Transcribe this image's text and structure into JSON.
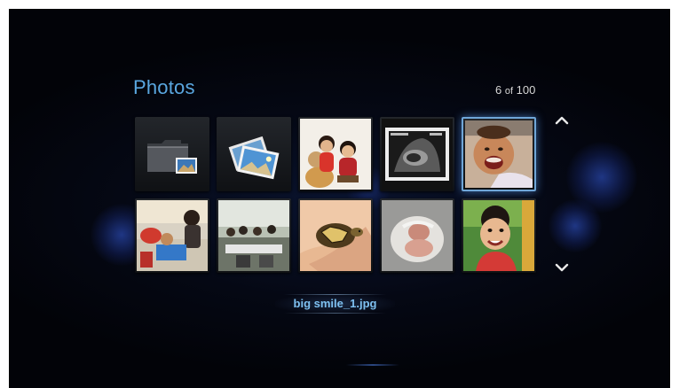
{
  "header": {
    "title": "Photos",
    "counter_current": "6",
    "counter_of": "of",
    "counter_total": "100"
  },
  "grid": {
    "items": [
      {
        "type": "folder",
        "icon": "folder-icon"
      },
      {
        "type": "slideshow",
        "icon": "photo-stack-icon"
      },
      {
        "type": "photo",
        "subject": "two children with teddy bear"
      },
      {
        "type": "photo",
        "subject": "ultrasound image"
      },
      {
        "type": "photo",
        "subject": "smiling baby",
        "selected": true
      },
      {
        "type": "photo",
        "subject": "child at party table"
      },
      {
        "type": "photo",
        "subject": "group at dinner table"
      },
      {
        "type": "photo",
        "subject": "small tortoise in hand"
      },
      {
        "type": "photo",
        "subject": "newborn baby"
      },
      {
        "type": "photo",
        "subject": "smiling boy outdoors"
      }
    ],
    "scroll_up_icon": "chevron-up-icon",
    "scroll_down_icon": "chevron-down-icon"
  },
  "selection": {
    "filename": "big smile_1.jpg"
  },
  "colors": {
    "title": "#5aa7e0",
    "filename": "#7ec0f0",
    "selection_border": "#6fa6d8",
    "background": "#050814"
  }
}
